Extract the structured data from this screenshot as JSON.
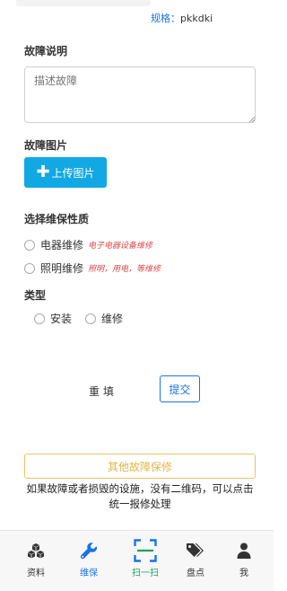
{
  "spec": {
    "key": "规格：",
    "value": "pkkdki"
  },
  "fault_desc": {
    "title": "故障说明",
    "placeholder": "描述故障"
  },
  "fault_images": {
    "title": "故障图片",
    "upload_label": "上传图片"
  },
  "repair_nature": {
    "title": "选择维保性质",
    "options": [
      {
        "label": "电器维修",
        "hint": "电子电器设备维修"
      },
      {
        "label": "照明维修",
        "hint": "照明，用电，等维修"
      }
    ]
  },
  "type": {
    "title": "类型",
    "options": [
      "安装",
      "维修"
    ]
  },
  "actions": {
    "reset": "重填",
    "submit": "提交"
  },
  "other": {
    "button": "其他故障保修",
    "note": "如果故障或者损毁的设施，没有二维码，可以点击统一报修处理"
  },
  "tabbar": [
    {
      "label": "资料",
      "icon": "cubes-icon"
    },
    {
      "label": "维保",
      "icon": "wrench-icon"
    },
    {
      "label": "扫一扫",
      "icon": "scan-icon"
    },
    {
      "label": "盘点",
      "icon": "tags-icon"
    },
    {
      "label": "我",
      "icon": "user-icon"
    }
  ],
  "colors": {
    "accent": "#1a73e8",
    "upload": "#12a8e3",
    "warning": "#e2b648",
    "scan": "#1ba35b",
    "hint": "#d94a4a"
  }
}
